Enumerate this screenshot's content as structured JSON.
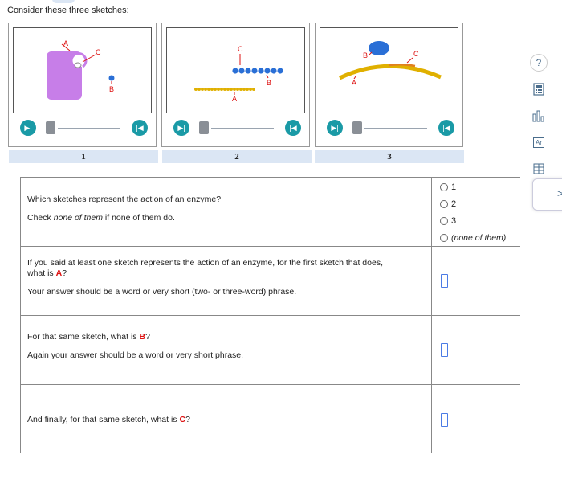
{
  "intro": "Consider these three sketches:",
  "sketches": [
    {
      "label": "1",
      "letters": {
        "a": "A",
        "b": "B",
        "c": "C"
      }
    },
    {
      "label": "2",
      "letters": {
        "a": "A",
        "b": "B",
        "c": "C"
      }
    },
    {
      "label": "3",
      "letters": {
        "a": "A",
        "b": "B",
        "c": "C"
      }
    }
  ],
  "questions": [
    {
      "line1": "Which sketches represent the action of an enzyme?",
      "line2_pre": "Check ",
      "line2_em": "none of them",
      "line2_post": " if none of them do.",
      "options": [
        "1",
        "2",
        "3",
        "(none of them)"
      ]
    },
    {
      "line1a": "If you said at least one sketch represents the action of an enzyme, for the first sketch that does,",
      "line1b_pre": "what is ",
      "line1b_red": "A",
      "line1b_post": "?",
      "line2": "Your answer should be a word or very short (two- or three-word) phrase."
    },
    {
      "line1_pre": "For that same sketch, what is ",
      "line1_red": "B",
      "line1_post": "?",
      "line2": "Again your answer should be a word or very short phrase."
    },
    {
      "line1_pre": "And finally, for that same sketch, what is ",
      "line1_red": "C",
      "line1_post": "?"
    }
  ],
  "toolbar": {
    "help": "?",
    "help_icon": "help-icon",
    "calculator_icon": "calculator-icon",
    "chart_icon": "bar-chart-icon",
    "periodic_icon": "periodic-table-icon",
    "periodic_text": "Ar",
    "data_icon": "data-table-icon"
  },
  "side_tab_arrow": ">",
  "colors": {
    "teal": "#1a9aa6",
    "accent_blue": "#4b7be5",
    "red": "#d11111",
    "label_bg": "#dbe6f4",
    "purple": "#c77ee8",
    "gold": "#e0b000",
    "blue": "#2a6fd6"
  }
}
